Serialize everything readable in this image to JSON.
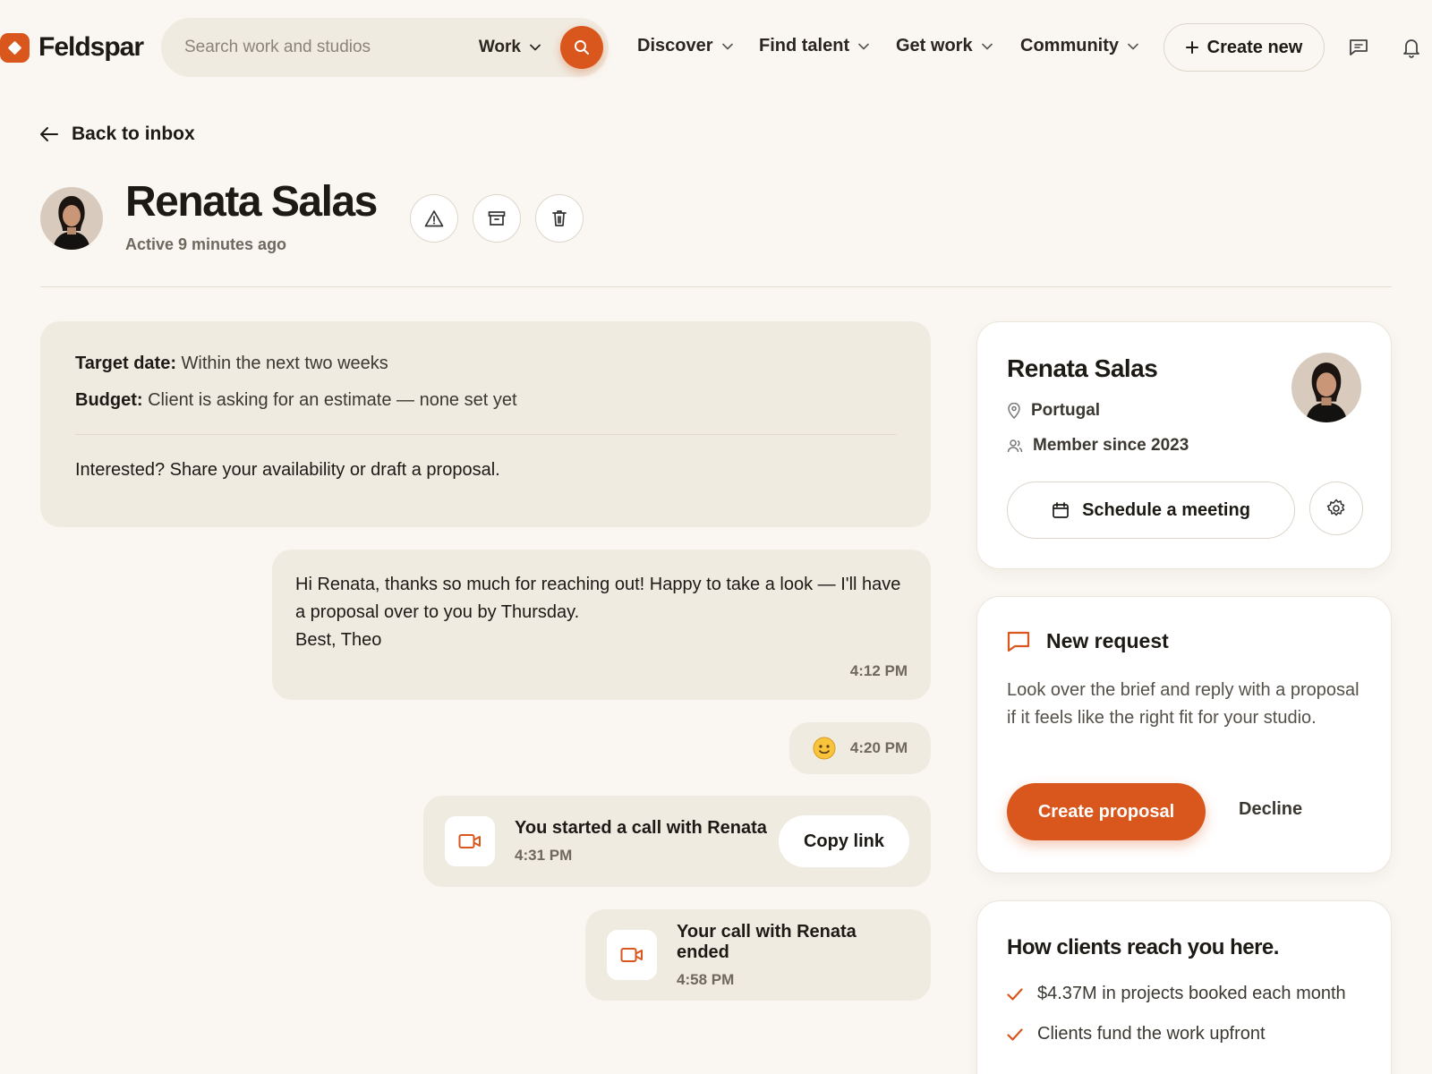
{
  "brand": {
    "name": "Feldspar",
    "accent": "#d9561c"
  },
  "search": {
    "placeholder": "Search work and studios",
    "scope": "Work"
  },
  "nav": {
    "items": [
      "Discover",
      "Find talent",
      "Get work",
      "Community"
    ],
    "create_new": "Create new"
  },
  "header": {
    "back_label": "Back to inbox",
    "name": "Renata Salas",
    "status": "Active 9 minutes ago"
  },
  "brief": {
    "target_label": "Target date:",
    "target_value": "Within the next two weeks",
    "budget_label": "Budget:",
    "budget_value": "Client is asking for an estimate — none set yet",
    "cta": "Interested? Share your availability or draft a proposal."
  },
  "messages": {
    "reply": {
      "text": "Hi Renata, thanks so much for reaching out! Happy to take a look — I'll have a proposal over to you by Thursday.\nBest, Theo",
      "time": "4:12 PM"
    },
    "reaction": {
      "emoji": "🙂",
      "time": "4:20 PM"
    },
    "call_started": {
      "title": "You started a call with Renata",
      "time": "4:31 PM",
      "action": "Copy link"
    },
    "call_ended": {
      "title": "Your call with Renata ended",
      "time": "4:58 PM"
    }
  },
  "profile": {
    "name": "Renata Salas",
    "location": "Portugal",
    "member_since": "Member since 2023",
    "schedule_label": "Schedule a meeting"
  },
  "request": {
    "title": "New request",
    "body": "Look over the brief and reply with a proposal if it feels like the right fit for your studio.",
    "primary": "Create proposal",
    "secondary": "Decline"
  },
  "reach": {
    "title": "How clients reach you here.",
    "items": [
      "$4.37M in projects booked each month",
      "Clients fund the work upfront"
    ]
  }
}
